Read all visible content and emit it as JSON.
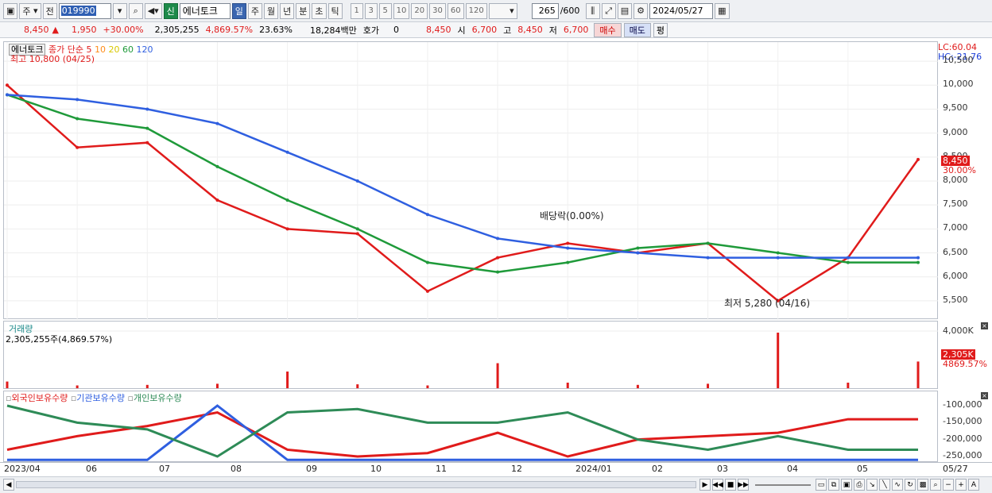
{
  "toolbar": {
    "type_label": "주",
    "all_label": "전",
    "code": "019990",
    "market_badge": "신",
    "stock_name": "에너토크",
    "periods": [
      "일",
      "주",
      "월",
      "년",
      "분",
      "초",
      "틱"
    ],
    "active_period": "일",
    "intervals": [
      "1",
      "3",
      "5",
      "10",
      "20",
      "30",
      "60",
      "120"
    ],
    "count": "265",
    "count_total": "/600",
    "date": "2024/05/27"
  },
  "quote": {
    "price": "8,450",
    "change": "1,950",
    "change_pct": "+30.00%",
    "volume": "2,305,255",
    "volume_pct": "4,869.57%",
    "turnover": "23.63%",
    "amount": "18,284백만",
    "hoga_label": "호가",
    "hoga_value": "0",
    "hoga_price": "8,450",
    "open_label": "시",
    "open": "6,700",
    "high_label": "고",
    "high": "8,450",
    "low_label": "저",
    "low": "6,700",
    "buy_label": "매수",
    "sell_label": "매도",
    "flat_label": "평"
  },
  "price_panel": {
    "legend_name": "에너토크",
    "legend_ma_label": "종가 단순 5",
    "ma_periods": [
      "10",
      "20",
      "60",
      "120"
    ],
    "ma_colors": [
      "#e01b1b",
      "#ff8c1a",
      "#f0e000",
      "#1f9a3a",
      "#2f5fe0"
    ],
    "high_note": "최고 10,800 (04/25)",
    "low_note": "최저 5,280 (04/16)",
    "dividend_note": "배당락(0.00%)",
    "lc": "LC:60.04",
    "hc": "HC:-21.76",
    "y_ticks": [
      "10,500",
      "10,000",
      "9,500",
      "9,000",
      "8,500",
      "8,000",
      "7,500",
      "7,000",
      "6,500",
      "6,000",
      "5,500"
    ],
    "last_price_badge": "8,450",
    "last_pct_badge": "30.00%"
  },
  "volume_panel": {
    "title": "거래량",
    "value_text": "2,305,255주(4,869.57%)",
    "y_tick": "4,000K",
    "badge": "2,305K",
    "badge_pct": "4869.57%"
  },
  "holding_panel": {
    "series": [
      {
        "name": "외국인보유수량",
        "color": "#e01b1b"
      },
      {
        "name": "기관보유수량",
        "color": "#2f5fe0"
      },
      {
        "name": "개인보유수량",
        "color": "#2e8b57"
      }
    ],
    "y_ticks": [
      "-100,000",
      "-150,000",
      "-200,000",
      "-250,000"
    ]
  },
  "x_axis": {
    "labels": [
      "2023/04",
      "06",
      "07",
      "08",
      "09",
      "10",
      "11",
      "12",
      "2024/01",
      "02",
      "03",
      "04",
      "05",
      "05/27"
    ]
  },
  "chart_data": {
    "type": "line",
    "title": "에너토크",
    "x": [
      "2023/04",
      "06",
      "07",
      "08",
      "09",
      "10",
      "11",
      "12",
      "2024/01",
      "02",
      "03",
      "04",
      "05",
      "05/27"
    ],
    "series": [
      {
        "name": "종가 단순 5",
        "values": [
          10000,
          8700,
          8800,
          7600,
          7000,
          6900,
          5700,
          6400,
          6700,
          6500,
          6700,
          5500,
          6400,
          8450
        ]
      },
      {
        "name": "60",
        "values": [
          9800,
          9300,
          9100,
          8300,
          7600,
          7000,
          6300,
          6100,
          6300,
          6600,
          6700,
          6500,
          6300,
          6300
        ]
      },
      {
        "name": "120",
        "values": [
          9800,
          9700,
          9500,
          9200,
          8600,
          8000,
          7300,
          6800,
          6600,
          6500,
          6400,
          6400,
          6400,
          6400
        ]
      }
    ],
    "ylim": [
      5200,
      10800
    ]
  }
}
